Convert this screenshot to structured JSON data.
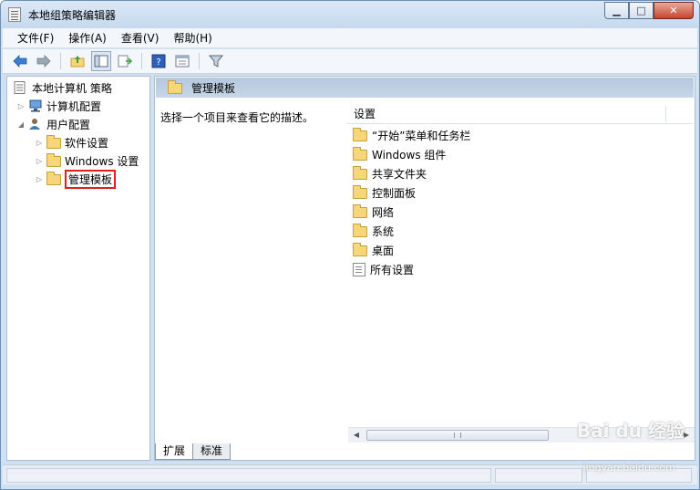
{
  "window": {
    "title": "本地组策略编辑器",
    "buttons": {
      "minimize": "▁",
      "maximize": "□",
      "close": "✕"
    }
  },
  "menu": [
    "文件(F)",
    "操作(A)",
    "查看(V)",
    "帮助(H)"
  ],
  "toolbar": {
    "icons": [
      "back-arrow-icon",
      "forward-arrow-icon",
      "up-folder-icon",
      "show-hide-tree-icon",
      "export-list-icon",
      "help-icon",
      "properties-icon",
      "filter-icon"
    ]
  },
  "tree": {
    "root": "本地计算机 策略",
    "computer_config": "计算机配置",
    "user_config": "用户配置",
    "software_settings": "软件设置",
    "windows_settings": "Windows 设置",
    "admin_templates": "管理模板"
  },
  "right": {
    "header": "管理模板",
    "description": "选择一个项目来查看它的描述。",
    "column_header": "设置",
    "items": [
      "“开始”菜单和任务栏",
      "Windows 组件",
      "共享文件夹",
      "控制面板",
      "网络",
      "系统",
      "桌面",
      "所有设置"
    ]
  },
  "tabs": [
    "扩展",
    "标准"
  ],
  "watermark": {
    "brand": "Bai du 经验",
    "url": "jingyan.baidu.com"
  },
  "colors": {
    "highlight_border": "#e0201a",
    "header_bg": "#b5c8de",
    "folder": "#f5d77a"
  }
}
